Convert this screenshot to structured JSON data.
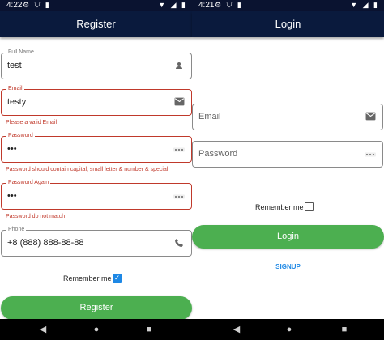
{
  "left_screen": {
    "status": {
      "time": "4:22"
    },
    "title": "Register",
    "fields": {
      "full_name": {
        "label": "Full Name",
        "value": "test",
        "icon": "person-icon"
      },
      "email": {
        "label": "Email",
        "value": "testy",
        "icon": "mail-icon",
        "error": "Please a valid Email"
      },
      "password": {
        "label": "Password",
        "value": "•••",
        "icon": "password-dots-icon",
        "error": "Password should contain capital, small letter & number & special"
      },
      "password_again": {
        "label": "Password Again",
        "value": "•••",
        "icon": "password-dots-icon",
        "error": "Password do not match"
      },
      "phone": {
        "label": "Phone",
        "value": "+8 (888) 888-88-88",
        "icon": "phone-icon"
      }
    },
    "remember": {
      "label": "Remember me",
      "checked": true
    },
    "register_button": "Register"
  },
  "right_screen": {
    "status": {
      "time": "4:21"
    },
    "title": "Login",
    "email_placeholder": "Email",
    "password_placeholder": "Password",
    "remember": {
      "label": "Remember me",
      "checked": false
    },
    "login_button": "Login",
    "signup_link": "SIGNUP"
  },
  "colors": {
    "appbar": "#0a1a3d",
    "error": "#c0392b",
    "accent": "#1e88e5",
    "button_green": "#4caf50"
  }
}
